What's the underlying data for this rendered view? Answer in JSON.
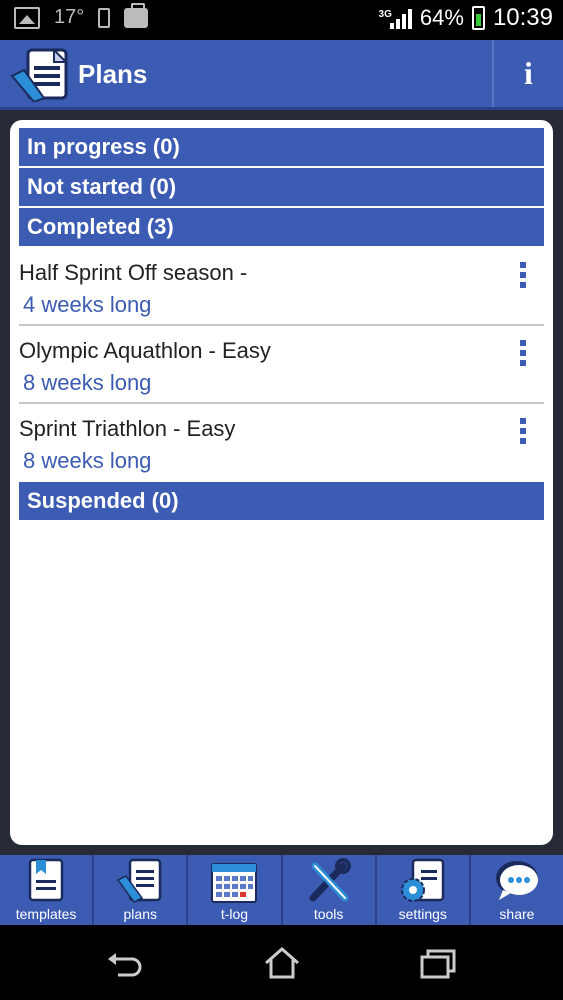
{
  "status_bar": {
    "temperature": "17°",
    "network": "3G",
    "battery": "64%",
    "time": "10:39"
  },
  "header": {
    "title": "Plans",
    "info_label": "i"
  },
  "sections": {
    "in_progress": "In progress (0)",
    "not_started": "Not started (0)",
    "completed": "Completed (3)",
    "suspended": "Suspended (0)"
  },
  "plans": [
    {
      "name": "Half Sprint Off season -",
      "length": "4 weeks long"
    },
    {
      "name": "Olympic Aquathlon - Easy",
      "length": "8 weeks long"
    },
    {
      "name": "Sprint Triathlon - Easy",
      "length": "8 weeks long"
    }
  ],
  "tabs": [
    {
      "label": "templates",
      "icon": "templates-icon"
    },
    {
      "label": "plans",
      "icon": "plans-icon"
    },
    {
      "label": "t-log",
      "icon": "calendar-icon"
    },
    {
      "label": "tools",
      "icon": "tools-icon"
    },
    {
      "label": "settings",
      "icon": "settings-icon"
    },
    {
      "label": "share",
      "icon": "share-icon"
    }
  ],
  "colors": {
    "accent": "#3c5bb3",
    "accent_dark": "#2c3f8c",
    "background": "#262a36"
  }
}
